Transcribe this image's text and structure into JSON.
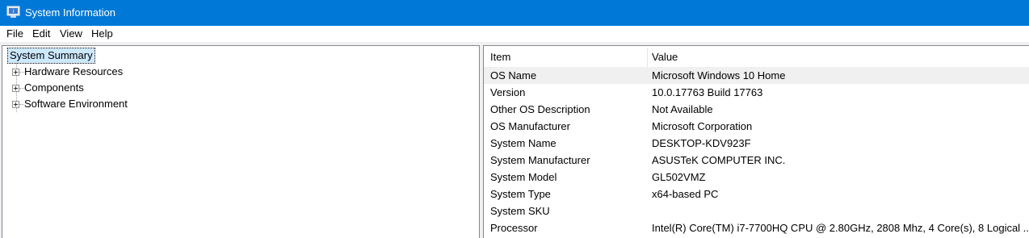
{
  "window": {
    "title": "System Information"
  },
  "menu": [
    "File",
    "Edit",
    "View",
    "Help"
  ],
  "tree": {
    "root": "System Summary",
    "children": [
      "Hardware Resources",
      "Components",
      "Software Environment"
    ]
  },
  "list": {
    "columns": [
      "Item",
      "Value"
    ],
    "rows": [
      {
        "item": "OS Name",
        "value": "Microsoft Windows 10 Home"
      },
      {
        "item": "Version",
        "value": "10.0.17763 Build 17763"
      },
      {
        "item": "Other OS Description",
        "value": "Not Available"
      },
      {
        "item": "OS Manufacturer",
        "value": "Microsoft Corporation"
      },
      {
        "item": "System Name",
        "value": "DESKTOP-KDV923F"
      },
      {
        "item": "System Manufacturer",
        "value": "ASUSTeK COMPUTER INC."
      },
      {
        "item": "System Model",
        "value": "GL502VMZ"
      },
      {
        "item": "System Type",
        "value": "x64-based PC"
      },
      {
        "item": "System SKU",
        "value": ""
      },
      {
        "item": "Processor",
        "value": "Intel(R) Core(TM) i7-7700HQ CPU @ 2.80GHz, 2808 Mhz, 4 Core(s), 8 Logical ..."
      }
    ]
  },
  "colors": {
    "titlebar": "#0078d7",
    "selection": "#cce8ff"
  },
  "icons": {
    "app": "system-information-icon",
    "expand": "plus-expander-icon"
  }
}
